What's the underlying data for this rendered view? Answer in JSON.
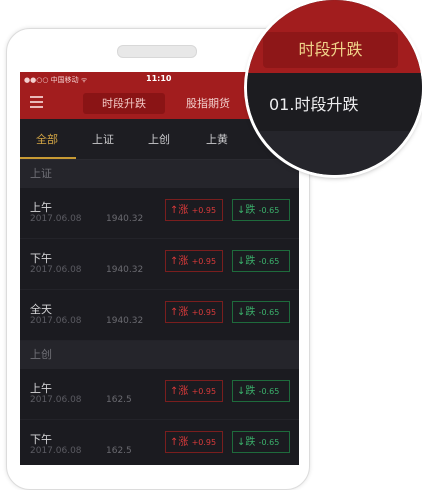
{
  "status": {
    "carrier": "●●○○ 中国移动 ᯤ",
    "time": "11:10"
  },
  "nav": {
    "tab_active": "时段升跌",
    "tab_other": "股指期货"
  },
  "markets": [
    "全部",
    "上证",
    "上创",
    "上黄"
  ],
  "sections": [
    {
      "title": "上证",
      "rows": [
        {
          "period": "上午",
          "date": "2017.06.08",
          "value": "1940.32",
          "up": "↑涨",
          "up_amt": "+0.95",
          "down": "↓跌",
          "down_amt": "-0.65"
        },
        {
          "period": "下午",
          "date": "2017.06.08",
          "value": "1940.32",
          "up": "↑涨",
          "up_amt": "+0.95",
          "down": "↓跌",
          "down_amt": "-0.65"
        },
        {
          "period": "全天",
          "date": "2017.06.08",
          "value": "1940.32",
          "up": "↑涨",
          "up_amt": "+0.95",
          "down": "↓跌",
          "down_amt": "-0.65"
        }
      ]
    },
    {
      "title": "上创",
      "rows": [
        {
          "period": "上午",
          "date": "2017.06.08",
          "value": "162.5",
          "up": "↑涨",
          "up_amt": "+0.95",
          "down": "↓跌",
          "down_amt": "-0.65"
        },
        {
          "period": "下午",
          "date": "2017.06.08",
          "value": "162.5",
          "up": "↑涨",
          "up_amt": "+0.95",
          "down": "↓跌",
          "down_amt": "-0.65"
        }
      ]
    }
  ],
  "magnifier": {
    "button": "时段升跌",
    "item": "01.时段升跌"
  },
  "colors": {
    "brand_red": "#a21d1e",
    "up": "#d93a3a",
    "down": "#3bb06b",
    "accent": "#d3a545"
  }
}
